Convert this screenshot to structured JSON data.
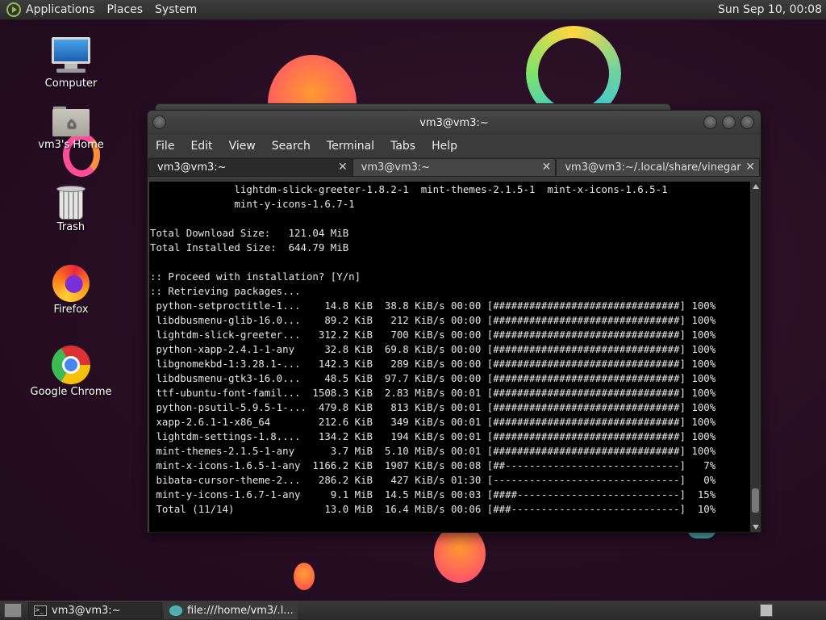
{
  "top_panel": {
    "menus": [
      "Applications",
      "Places",
      "System"
    ],
    "clock": "Sun Sep 10, 00:08"
  },
  "desktop_icons": [
    {
      "label": "Computer",
      "icon": "computer-icon"
    },
    {
      "label": "vm3's Home",
      "icon": "home-folder-icon"
    },
    {
      "label": "Trash",
      "icon": "trash-icon"
    },
    {
      "label": "Firefox",
      "icon": "firefox-icon"
    },
    {
      "label": "Google Chrome",
      "icon": "chrome-icon"
    }
  ],
  "window": {
    "title": "vm3@vm3:~",
    "menu": [
      "File",
      "Edit",
      "View",
      "Search",
      "Terminal",
      "Tabs",
      "Help"
    ],
    "tabs": [
      {
        "label": "vm3@vm3:~",
        "active": true
      },
      {
        "label": "vm3@vm3:~",
        "active": false
      },
      {
        "label": "vm3@vm3:~/.local/share/vinegar",
        "active": false
      }
    ],
    "tab_close": "✕"
  },
  "terminal": {
    "lines": [
      "              lightdm-slick-greeter-1.8.2-1  mint-themes-2.1.5-1  mint-x-icons-1.6.5-1",
      "              mint-y-icons-1.6.7-1",
      "",
      "Total Download Size:   121.04 MiB",
      "Total Installed Size:  644.79 MiB",
      "",
      ":: Proceed with installation? [Y/n]",
      ":: Retrieving packages...",
      " python-setproctitle-1...    14.8 KiB  38.8 KiB/s 00:00 [###############################] 100%",
      " libdbusmenu-glib-16.0...    89.2 KiB   212 KiB/s 00:00 [###############################] 100%",
      " lightdm-slick-greeter...   312.2 KiB   700 KiB/s 00:00 [###############################] 100%",
      " python-xapp-2.4.1-1-any     32.8 KiB  69.8 KiB/s 00:00 [###############################] 100%",
      " libgnomekbd-1:3.28.1-...   142.3 KiB   289 KiB/s 00:00 [###############################] 100%",
      " libdbusmenu-gtk3-16.0...    48.5 KiB  97.7 KiB/s 00:00 [###############################] 100%",
      " ttf-ubuntu-font-famil...  1508.3 KiB  2.83 MiB/s 00:01 [###############################] 100%",
      " python-psutil-5.9.5-1-...  479.8 KiB   813 KiB/s 00:01 [###############################] 100%",
      " xapp-2.6.1-1-x86_64        212.6 KiB   349 KiB/s 00:01 [###############################] 100%",
      " lightdm-settings-1.8....   134.2 KiB   194 KiB/s 00:01 [###############################] 100%",
      " mint-themes-2.1.5-1-any      3.7 MiB  5.10 MiB/s 00:01 [###############################] 100%",
      " mint-x-icons-1.6.5-1-any  1166.2 KiB  1907 KiB/s 00:08 [##-----------------------------]   7%",
      " bibata-cursor-theme-2...   286.2 KiB   427 KiB/s 01:30 [-------------------------------]   0%",
      " mint-y-icons-1.6.7-1-any     9.1 MiB  14.5 MiB/s 00:03 [####---------------------------]  15%",
      " Total (11/14)               13.0 MiB  16.4 MiB/s 00:06 [###----------------------------]  10%"
    ]
  },
  "taskbar": {
    "items": [
      {
        "label": "vm3@vm3:~",
        "icon": "terminal-icon",
        "active": true
      },
      {
        "label": "file:///home/vm3/.l...",
        "icon": "web-app-icon",
        "active": false
      }
    ]
  }
}
